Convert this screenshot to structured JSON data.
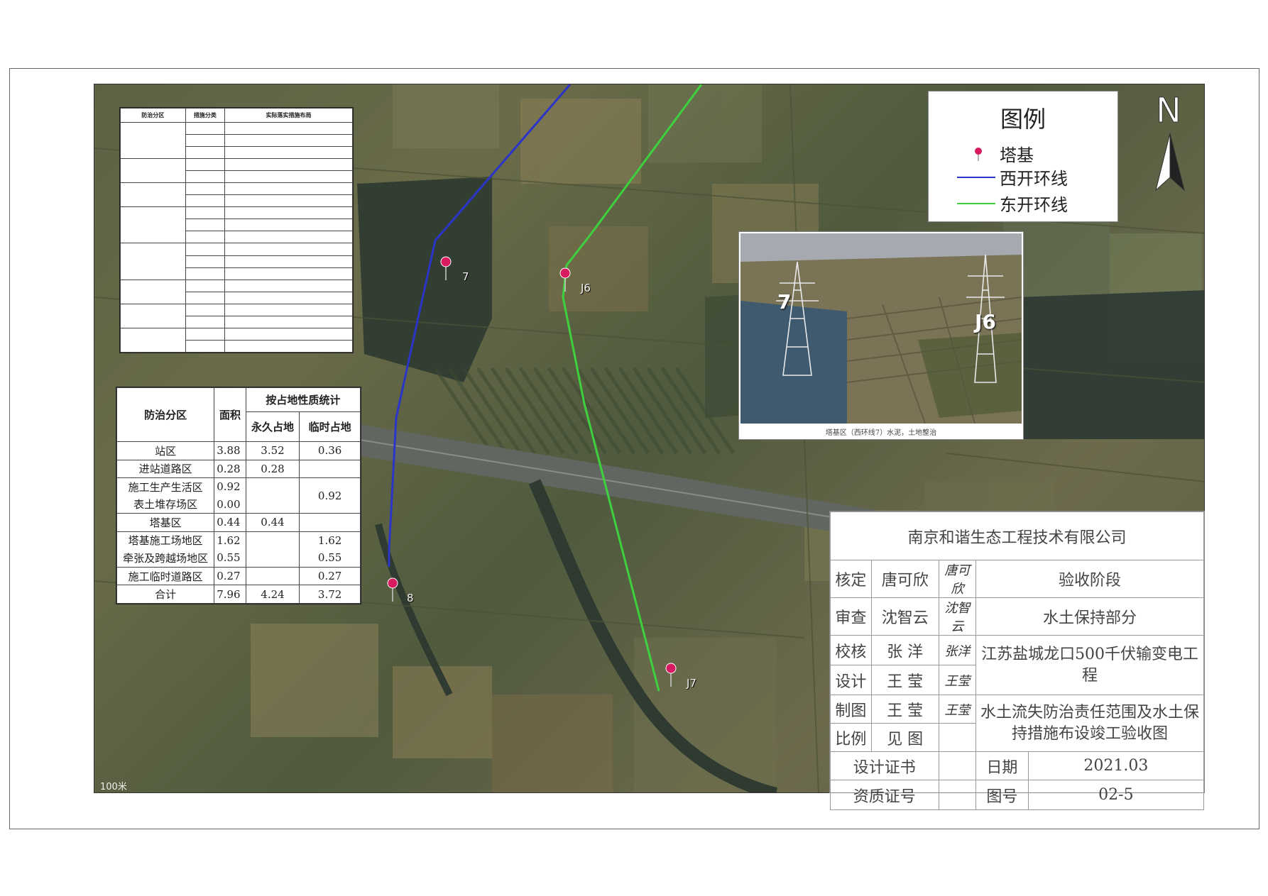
{
  "legend": {
    "title": "图例",
    "items": [
      {
        "label": "塔基",
        "symbol": "pin-icon",
        "color": "#d81b60"
      },
      {
        "label": "西开环线",
        "symbol": "line",
        "color": "#2b35c8"
      },
      {
        "label": "东开环线",
        "symbol": "line",
        "color": "#3ed13e"
      }
    ]
  },
  "north_label": "N",
  "towers": [
    {
      "label": "7"
    },
    {
      "label": "J6"
    },
    {
      "label": "8"
    },
    {
      "label": "J7"
    }
  ],
  "scale_label": "100米",
  "photo": {
    "tower_labels": [
      "7",
      "J6"
    ],
    "caption": "塔基区（西环线7）水泥，土地整治"
  },
  "measures_table": {
    "headers": [
      "防治分区",
      "措施分类",
      "实际落实措施布局"
    ],
    "note": "cell text not legible in source"
  },
  "stats_table": {
    "header_zone": "防治分区",
    "header_group": "按占地性质统计",
    "header_area": "面积",
    "header_perm": "永久占地",
    "header_temp": "临时占地",
    "rows": [
      {
        "zone": "站区",
        "area": "3.88",
        "perm": "3.52",
        "temp": "0.36"
      },
      {
        "zone": "进站道路区",
        "area": "0.28",
        "perm": "0.28",
        "temp": ""
      },
      {
        "zone": "施工生产生活区",
        "area": "0.92",
        "perm": "",
        "temp": "0.92"
      },
      {
        "zone": "表土堆存场区",
        "area": "0.00",
        "perm": "",
        "temp": ""
      },
      {
        "zone": "塔基区",
        "area": "0.44",
        "perm": "0.44",
        "temp": ""
      },
      {
        "zone": "塔基施工场地区",
        "area": "1.62",
        "perm": "",
        "temp": "1.62"
      },
      {
        "zone": "牵张及跨越场地区",
        "area": "0.55",
        "perm": "",
        "temp": "0.55"
      },
      {
        "zone": "施工临时道路区",
        "area": "0.27",
        "perm": "",
        "temp": "0.27"
      },
      {
        "zone": "合计",
        "area": "7.96",
        "perm": "4.24",
        "temp": "3.72"
      }
    ]
  },
  "title_block": {
    "company": "南京和谐生态工程技术有限公司",
    "rows": [
      {
        "role": "核定",
        "name": "唐可欣",
        "signature": "唐可欣"
      },
      {
        "role": "审查",
        "name": "沈智云",
        "signature": "沈智云"
      },
      {
        "role": "校核",
        "name": "张 洋",
        "signature": "张洋"
      },
      {
        "role": "设计",
        "name": "王 莹",
        "signature": "王莹"
      },
      {
        "role": "制图",
        "name": "王 莹",
        "signature": "王莹"
      },
      {
        "role": "比例",
        "name": "见 图",
        "signature": ""
      }
    ],
    "stage": "验收阶段",
    "department": "水土保持部分",
    "project": "江苏盐城龙口500千伏输变电工程",
    "drawing_title": "水土流失防治责任范围及水土保持措施布设竣工验收图",
    "cert_design": "设计证书",
    "cert_quality": "资质证号",
    "date_label": "日期",
    "date_value": "2021.03",
    "drawing_no_label": "图号",
    "drawing_no_value": "02-5"
  }
}
